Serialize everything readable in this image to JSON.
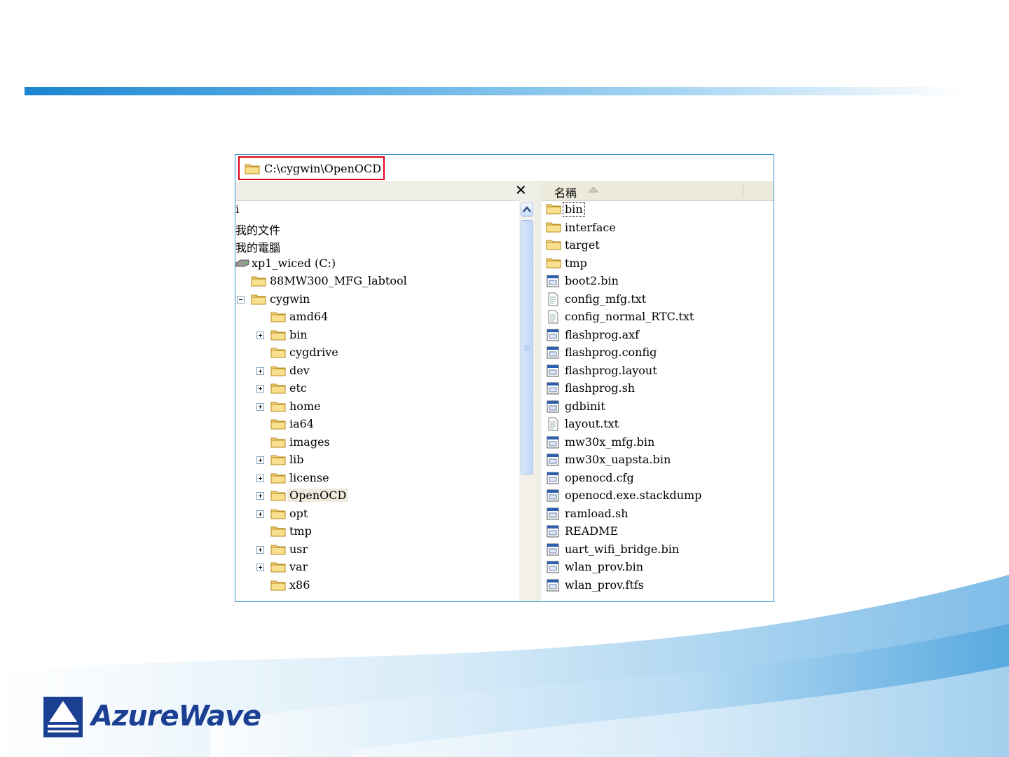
{
  "branding": {
    "logo_text": "AzureWave",
    "accent": "#1b3f93"
  },
  "explorer": {
    "address": {
      "path": "C:\\cygwin\\OpenOCD",
      "icon": "folder-icon"
    },
    "folders_pane": {
      "close_label": "✕",
      "tree": [
        {
          "label": "i",
          "indent": 0,
          "icon": "none",
          "expander": ""
        },
        {
          "label": "我的文件",
          "indent": 0,
          "icon": "none",
          "expander": ""
        },
        {
          "label": "我的電腦",
          "indent": 0,
          "icon": "none",
          "expander": ""
        },
        {
          "label": "xp1_wiced (C:)",
          "indent": 0,
          "icon": "drive-icon",
          "expander": ""
        },
        {
          "label": "88MW300_MFG_labtool",
          "indent": 1,
          "icon": "folder-icon",
          "expander": ""
        },
        {
          "label": "cygwin",
          "indent": 1,
          "icon": "folder-icon",
          "expander": "minus"
        },
        {
          "label": "amd64",
          "indent": 2,
          "icon": "folder-icon",
          "expander": ""
        },
        {
          "label": "bin",
          "indent": 2,
          "icon": "folder-icon",
          "expander": "plus"
        },
        {
          "label": "cygdrive",
          "indent": 2,
          "icon": "folder-icon",
          "expander": ""
        },
        {
          "label": "dev",
          "indent": 2,
          "icon": "folder-icon",
          "expander": "plus"
        },
        {
          "label": "etc",
          "indent": 2,
          "icon": "folder-icon",
          "expander": "plus"
        },
        {
          "label": "home",
          "indent": 2,
          "icon": "folder-icon",
          "expander": "plus"
        },
        {
          "label": "ia64",
          "indent": 2,
          "icon": "folder-icon",
          "expander": ""
        },
        {
          "label": "images",
          "indent": 2,
          "icon": "folder-icon",
          "expander": ""
        },
        {
          "label": "lib",
          "indent": 2,
          "icon": "folder-icon",
          "expander": "plus"
        },
        {
          "label": "license",
          "indent": 2,
          "icon": "folder-icon",
          "expander": "plus"
        },
        {
          "label": "OpenOCD",
          "indent": 2,
          "icon": "folder-icon",
          "expander": "plus",
          "selected": true
        },
        {
          "label": "opt",
          "indent": 2,
          "icon": "folder-icon",
          "expander": "plus"
        },
        {
          "label": "tmp",
          "indent": 2,
          "icon": "folder-icon",
          "expander": ""
        },
        {
          "label": "usr",
          "indent": 2,
          "icon": "folder-icon",
          "expander": "plus"
        },
        {
          "label": "var",
          "indent": 2,
          "icon": "folder-icon",
          "expander": "plus"
        },
        {
          "label": "x86",
          "indent": 2,
          "icon": "folder-icon",
          "expander": ""
        }
      ]
    },
    "file_list": {
      "column_name": "名稱",
      "sort": "ascending",
      "items": [
        {
          "name": "bin",
          "type": "folder"
        },
        {
          "name": "interface",
          "type": "folder"
        },
        {
          "name": "target",
          "type": "folder"
        },
        {
          "name": "tmp",
          "type": "folder"
        },
        {
          "name": "boot2.bin",
          "type": "file"
        },
        {
          "name": "config_mfg.txt",
          "type": "text"
        },
        {
          "name": "config_normal_RTC.txt",
          "type": "text"
        },
        {
          "name": "flashprog.axf",
          "type": "file"
        },
        {
          "name": "flashprog.config",
          "type": "file"
        },
        {
          "name": "flashprog.layout",
          "type": "file"
        },
        {
          "name": "flashprog.sh",
          "type": "file"
        },
        {
          "name": "gdbinit",
          "type": "file"
        },
        {
          "name": "layout.txt",
          "type": "text"
        },
        {
          "name": "mw30x_mfg.bin",
          "type": "file"
        },
        {
          "name": "mw30x_uapsta.bin",
          "type": "file"
        },
        {
          "name": "openocd.cfg",
          "type": "file"
        },
        {
          "name": "openocd.exe.stackdump",
          "type": "file"
        },
        {
          "name": "ramload.sh",
          "type": "file"
        },
        {
          "name": "README",
          "type": "file"
        },
        {
          "name": "uart_wifi_bridge.bin",
          "type": "file"
        },
        {
          "name": "wlan_prov.bin",
          "type": "file"
        },
        {
          "name": "wlan_prov.ftfs",
          "type": "file"
        }
      ]
    }
  }
}
